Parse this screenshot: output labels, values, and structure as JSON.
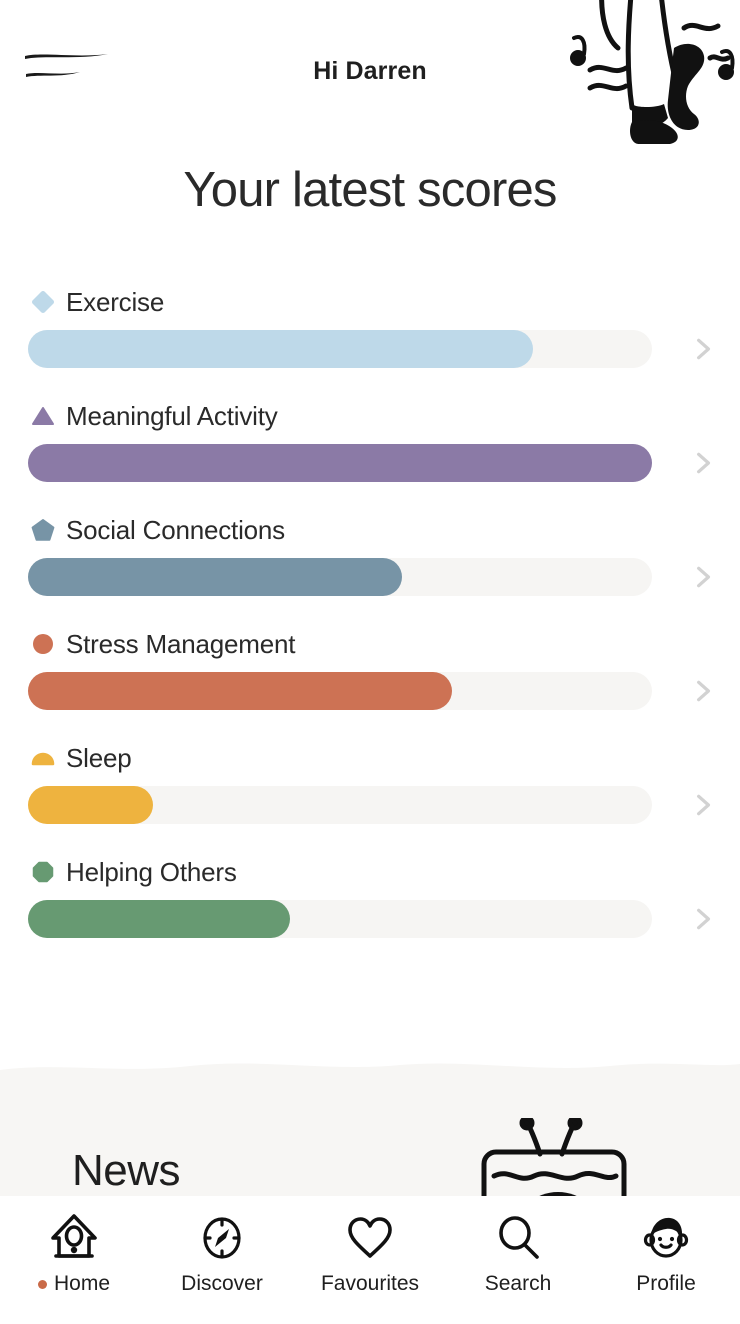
{
  "header": {
    "greeting": "Hi Darren",
    "menu_icon": "hamburger-menu-icon",
    "illustration": "dancing-legs-illustration"
  },
  "page_title": "Your latest scores",
  "colors": {
    "track": "#f6f5f3",
    "chevron": "#d2d2d2",
    "text": "#2a2a2a",
    "active_dot": "#c96a48",
    "news_bg": "#f7f6f4"
  },
  "chart_data": {
    "type": "bar",
    "title": "Your latest scores",
    "xlabel": "",
    "ylabel": "",
    "xlim": [
      0,
      100
    ],
    "grid": false,
    "legend": "none",
    "orientation": "horizontal",
    "categories": [
      "Exercise",
      "Meaningful Activity",
      "Social Connections",
      "Stress Management",
      "Sleep",
      "Helping Others"
    ],
    "values": [
      81,
      100,
      60,
      68,
      20,
      42
    ],
    "colors": [
      "#bed9e9",
      "#8b7aa6",
      "#7794a6",
      "#cd7254",
      "#eeb33f",
      "#679a72"
    ]
  },
  "scores": [
    {
      "label": "Exercise",
      "shape": "diamond-icon",
      "color": "#bed9e9",
      "value": 81
    },
    {
      "label": "Meaningful Activity",
      "shape": "triangle-icon",
      "color": "#8b7aa6",
      "value": 100
    },
    {
      "label": "Social Connections",
      "shape": "pentagon-icon",
      "color": "#7794a6",
      "value": 60
    },
    {
      "label": "Stress Management",
      "shape": "circle-icon",
      "color": "#cd7254",
      "value": 68
    },
    {
      "label": "Sleep",
      "shape": "dome-icon",
      "color": "#eeb33f",
      "value": 20
    },
    {
      "label": "Helping Others",
      "shape": "octagon-icon",
      "color": "#679a72",
      "value": 42
    }
  ],
  "news": {
    "title": "News",
    "illustration": "television-illustration"
  },
  "bottom_nav": {
    "items": [
      {
        "label": "Home",
        "icon": "birdhouse-icon",
        "active": true
      },
      {
        "label": "Discover",
        "icon": "compass-icon",
        "active": false
      },
      {
        "label": "Favourites",
        "icon": "heart-icon",
        "active": false
      },
      {
        "label": "Search",
        "icon": "magnifying-glass-icon",
        "active": false
      },
      {
        "label": "Profile",
        "icon": "face-icon",
        "active": false
      }
    ]
  }
}
